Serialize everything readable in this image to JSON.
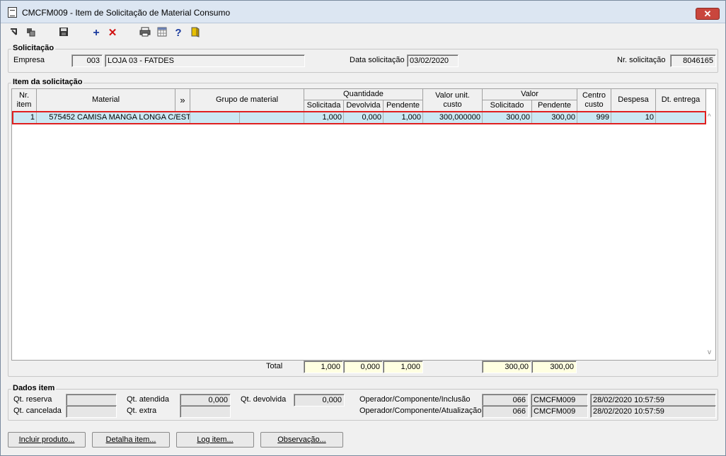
{
  "window": {
    "title": "CMCFM009 - Item de Solicitação de Material Consumo",
    "close_label": "✕"
  },
  "toolbar": {
    "icons": [
      "first-record-icon",
      "copy-icon",
      "save-icon",
      "add-icon",
      "delete-icon",
      "print-icon",
      "grid-icon",
      "help-icon",
      "exit-icon"
    ]
  },
  "solicitacao": {
    "group_title": "Solicitação",
    "empresa_label": "Empresa",
    "empresa_code": "003",
    "empresa_name": "LOJA 03 - FATDES",
    "data_label": "Data solicitação",
    "data_value": "03/02/2020",
    "nr_label": "Nr. solicitação",
    "nr_value": "8046165"
  },
  "item": {
    "group_title": "Item da solicitação",
    "headers": {
      "nr_item": "Nr.\nitem",
      "material": "Material",
      "expand": "»",
      "grupo": "Grupo de material",
      "quantidade": "Quantidade",
      "solicitada": "Solicitada",
      "devolvida": "Devolvida",
      "pendente": "Pendente",
      "valor_unit": "Valor unit.\ncusto",
      "valor": "Valor",
      "val_solicitado": "Solicitado",
      "val_pendente": "Pendente",
      "centro": "Centro\ncusto",
      "despesa": "Despesa",
      "dt_entrega": "Dt. entrega"
    },
    "rows": [
      {
        "nr": "1",
        "material_code": "575452",
        "material_desc": "CAMISA MANGA LONGA C/ESTA",
        "grupo_code": "",
        "grupo_desc": "",
        "solicitada": "1,000",
        "devolvida": "0,000",
        "pendente": "1,000",
        "valor_unit": "300,000000",
        "val_solicitado": "300,00",
        "val_pendente": "300,00",
        "centro": "999",
        "despesa": "10",
        "dt_entrega": ""
      }
    ],
    "totals": {
      "label": "Total",
      "solicitada": "1,000",
      "devolvida": "0,000",
      "pendente": "1,000",
      "val_solicitado": "300,00",
      "val_pendente": "300,00"
    }
  },
  "dados": {
    "group_title": "Dados item",
    "qt_reserva_label": "Qt. reserva",
    "qt_reserva": "",
    "qt_cancelada_label": "Qt. cancelada",
    "qt_cancelada": "",
    "qt_atendida_label": "Qt. atendida",
    "qt_atendida": "0,000",
    "qt_extra_label": "Qt. extra",
    "qt_extra": "",
    "qt_devolvida_label": "Qt. devolvida",
    "qt_devolvida": "0,000",
    "op_inc_label": "Operador/Componente/Inclusão",
    "op_inc_operador": "066",
    "op_inc_componente": "CMCFM009",
    "op_inc_data": "28/02/2020 10:57:59",
    "op_atu_label": "Operador/Componente/Atualização",
    "op_atu_operador": "066",
    "op_atu_componente": "CMCFM009",
    "op_atu_data": "28/02/2020 10:57:59"
  },
  "buttons": {
    "incluir": "Incluir produto...",
    "detalha": "Detalha item...",
    "log": "Log item...",
    "observacao": "Observação..."
  }
}
